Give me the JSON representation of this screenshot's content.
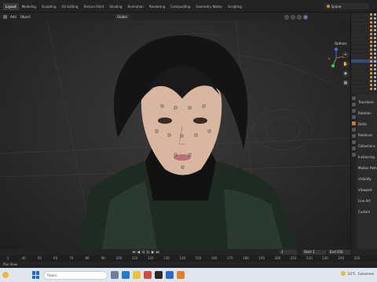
{
  "workspaces": [
    "Layout",
    "Modeling",
    "Sculpting",
    "UV Editing",
    "Texture Paint",
    "Shading",
    "Animation",
    "Rendering",
    "Compositing",
    "Geometry Nodes",
    "Scripting"
  ],
  "active_workspace": "Layout",
  "scene": {
    "label": "Scene"
  },
  "viewport_header": {
    "menu": [
      "Add",
      "Object"
    ],
    "orientation": "Global",
    "options_label": "Options"
  },
  "timeline": {
    "current_frame": "1",
    "start_label": "Start",
    "start_value": "1",
    "end_label": "End",
    "end_value": "250",
    "ruler_ticks": [
      "1",
      "40",
      "50",
      "60",
      "70",
      "80",
      "90",
      "100",
      "110",
      "120",
      "130",
      "140",
      "150",
      "160",
      "170",
      "180",
      "190",
      "200",
      "210",
      "220",
      "230",
      "240",
      "250"
    ]
  },
  "status": {
    "text": "Pan View"
  },
  "taskbar": {
    "search_placeholder": "Поиск",
    "weather_temp": "24°C",
    "weather_text": "Солнечно"
  },
  "properties": {
    "rows": [
      "Transform",
      "Rotation",
      "Delta",
      "Relations",
      "Collections",
      "Instancing",
      "Motion Paths",
      "Visibility",
      "Viewport",
      "Line Art",
      "Custom"
    ]
  },
  "colors": {
    "accent": "#3c6fd6",
    "selected": "#334d80",
    "active_tab": "#d07a3a"
  }
}
